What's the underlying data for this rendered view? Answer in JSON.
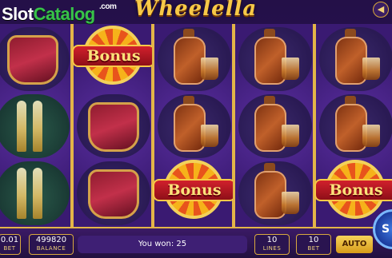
{
  "brand": {
    "slot": "Slot",
    "catalog": "Catalog",
    "com": ".com"
  },
  "game": {
    "title": "Wheelella"
  },
  "icons": {
    "menu": "speaker-icon"
  },
  "symbols": {
    "bonus_label": "Bonus"
  },
  "bottom_bar": {
    "bet_value": "0.01",
    "bet_label": "BET",
    "balance_value": "499820",
    "balance_label": "BALANCE",
    "win_text": "You won: 25",
    "lines_value": "10",
    "lines_label": "LINES",
    "bet2_value": "10",
    "bet2_label": "BET",
    "auto_label": "AUTO",
    "spin_label": "S"
  },
  "colors": {
    "frame_gold": "#e3b548",
    "bonus_red": "#d1202c",
    "spin_blue": "#3e78e0"
  }
}
